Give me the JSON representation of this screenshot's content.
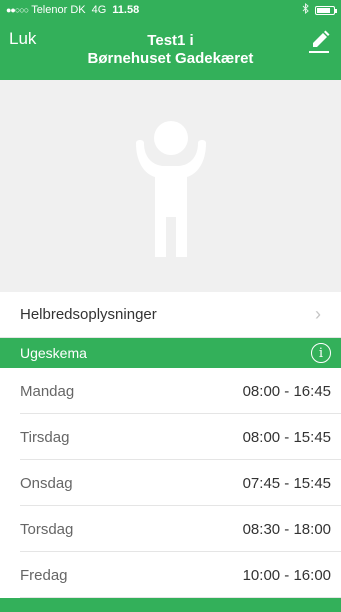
{
  "status_bar": {
    "signal": "●●○○○",
    "carrier": "Telenor DK",
    "network": "4G",
    "time": "11.58",
    "bluetooth_icon": "bluetooth-icon",
    "battery_icon": "battery-icon"
  },
  "nav": {
    "close_label": "Luk",
    "title_line1": "Test1 i",
    "title_line2": "Børnehuset Gadekæret",
    "edit_icon": "pencil-icon"
  },
  "hero": {
    "icon": "child-silhouette-icon"
  },
  "health": {
    "label": "Helbredsoplysninger",
    "chevron": "›"
  },
  "schedule": {
    "title": "Ugeskema",
    "info_glyph": "i",
    "days": [
      {
        "name": "Mandag",
        "hours": "08:00 - 16:45"
      },
      {
        "name": "Tirsdag",
        "hours": "08:00 - 15:45"
      },
      {
        "name": "Onsdag",
        "hours": "07:45 - 15:45"
      },
      {
        "name": "Torsdag",
        "hours": "08:30 - 18:00"
      },
      {
        "name": "Fredag",
        "hours": "10:00 - 16:00"
      }
    ]
  },
  "colors": {
    "brand_green": "#33b05a",
    "hero_background": "#f0f0f0",
    "silhouette": "#ffffff"
  }
}
